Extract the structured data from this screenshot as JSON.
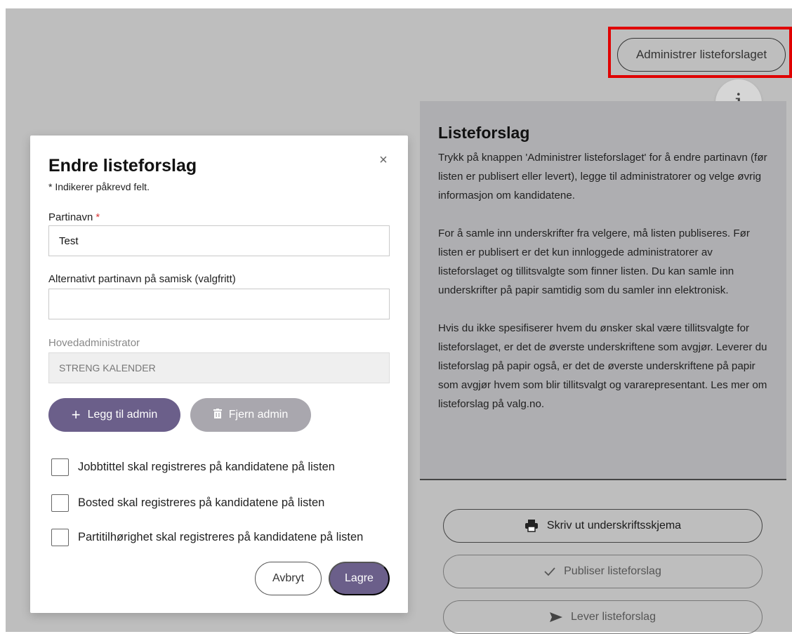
{
  "header": {
    "admin_button_label": "Administrer listeforslaget",
    "info_icon_glyph": "i"
  },
  "info_panel": {
    "title": "Listeforslag",
    "paragraphs": [
      "Trykk på knappen 'Administrer listeforslaget' for å endre partinavn (før listen er publisert eller levert), legge til administratorer og velge øvrig informasjon om kandidatene.",
      "For å samle inn underskrifter fra velgere, må listen publiseres. Før listen er publisert er det kun innloggede administratorer av listeforslaget og tillitsvalgte som finner listen. Du kan samle inn underskrifter på papir samtidig som du samler inn elektronisk.",
      "Hvis du ikke spesifiserer hvem du ønsker skal være tillitsvalgte for listeforslaget, er det de øverste underskriftene som avgjør. Leverer du listeforslag på papir også, er det de øverste underskriftene på papir som avgjør hvem som blir tillitsvalgt og vararepresentant. Les mer om listeforslag på valg.no."
    ]
  },
  "side_actions": {
    "print_label": "Skriv ut underskriftsskjema",
    "publish_label": "Publiser listeforslag",
    "submit_label": "Lever listeforslag",
    "print_icon": "printer-icon",
    "publish_icon": "checkmark-icon",
    "submit_icon": "send-icon"
  },
  "modal": {
    "title": "Endre listeforslag",
    "close_glyph": "×",
    "required_note": "* Indikerer påkrevd felt.",
    "party_name": {
      "label": "Partinavn",
      "required_marker": "*",
      "value": "Test"
    },
    "sami_name": {
      "label": "Alternativt partinavn på samisk (valgfritt)",
      "value": ""
    },
    "main_admin": {
      "label": "Hovedadministrator",
      "value": "STRENG KALENDER"
    },
    "add_admin_label": "Legg til admin",
    "remove_admin_label": "Fjern admin",
    "checkboxes": [
      {
        "label": "Jobbtittel skal registreres på kandidatene på listen",
        "checked": false
      },
      {
        "label": "Bosted skal registreres på kandidatene på listen",
        "checked": false
      },
      {
        "label": "Partitilhørighet skal registreres på kandidatene på listen",
        "checked": false
      }
    ],
    "cancel_label": "Avbryt",
    "save_label": "Lagre"
  },
  "colors": {
    "overlay": "#bebebe",
    "panel": "#aeaeb1",
    "primary": "#6b5f8a",
    "disabled": "#a9a7ae",
    "highlight": "#e00000"
  }
}
